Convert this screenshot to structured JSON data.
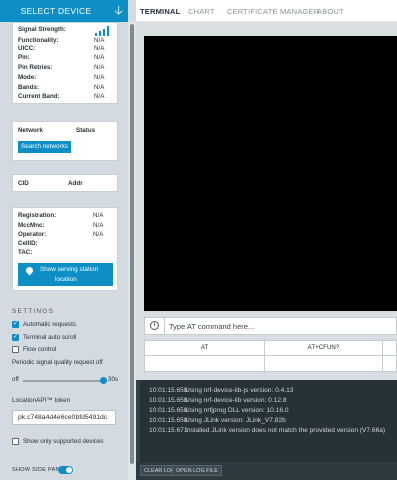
{
  "colors": {
    "accent": "#0d8fc6",
    "sidebar_bg": "#d4dbe0",
    "log_bg": "#263238",
    "terminal_bg": "#000000"
  },
  "sidebar": {
    "select_device": {
      "label": "SELECT DEVICE",
      "icon": "arrow-down-icon"
    },
    "device_info": [
      {
        "key": "Signal Strength:",
        "value": ""
      },
      {
        "key": "Functionality:",
        "value": "N/A"
      },
      {
        "key": "UICC:",
        "value": "N/A"
      },
      {
        "key": "Pin:",
        "value": "N/A"
      },
      {
        "key": "Pin Retries:",
        "value": "N/A"
      },
      {
        "key": "Mode:",
        "value": "N/A"
      },
      {
        "key": "Bands:",
        "value": "N/A"
      },
      {
        "key": "Current Band:",
        "value": "N/A"
      }
    ],
    "network": {
      "col_network": "Network",
      "col_status": "Status",
      "search_button": "Search networks"
    },
    "cells": {
      "col_cid": "CID",
      "col_addr": "Addr"
    },
    "registration": [
      {
        "key": "Registration:",
        "value": "N/A"
      },
      {
        "key": "MccMnc:",
        "value": "N/A"
      },
      {
        "key": "Operator:",
        "value": "N/A"
      },
      {
        "key": "CellID:",
        "value": ""
      },
      {
        "key": "TAC:",
        "value": ""
      }
    ],
    "show_station_button": {
      "line1": "Show serving station",
      "line2": "location",
      "icon": "location-pin-icon"
    },
    "settings": {
      "title": "SETTINGS",
      "automatic_requests": {
        "label": "Automatic requests",
        "checked": true
      },
      "terminal_auto_scroll": {
        "label": "Terminal auto scroll",
        "checked": true
      },
      "flow_control": {
        "label": "Flow control",
        "checked": false
      },
      "periodic_label": "Periodic signal quality request off",
      "slider_min": "off",
      "slider_max": "30s",
      "slider_value_fraction": 1.0,
      "token_label": "LocationAPI™ token",
      "token_value": "pk.c748a4d4e6ce0bfd5491dc",
      "supported_devices": {
        "label": "Show only supported devices",
        "checked": false
      }
    },
    "show_side_panel": {
      "label": "SHOW SIDE PANEL",
      "on": true
    }
  },
  "tabs": [
    {
      "label": "TERMINAL",
      "active": true
    },
    {
      "label": "CHART",
      "active": false
    },
    {
      "label": "CERTIFICATE MANAGER",
      "active": false
    },
    {
      "label": "ABOUT",
      "active": false
    }
  ],
  "terminal": {
    "command_placeholder": "Type AT command here...",
    "info_icon": "info-icon",
    "table_headers": [
      "AT",
      "AT+CFUN?"
    ]
  },
  "log": {
    "lines": [
      {
        "time": "10:01:15.658",
        "message": "Using nrf-device-lib-js version: 0.4.13"
      },
      {
        "time": "10:01:15.658",
        "message": "Using nrf-device-lib version: 0.12.8"
      },
      {
        "time": "10:01:15.658",
        "message": "Using nrfjprog DLL version: 10.16.0"
      },
      {
        "time": "10:01:15.658",
        "message": "Using JLink version: JLink_V7.82b"
      },
      {
        "time": "10:01:15.671",
        "message": "Installed JLink version does not match the provided version (V7.66a)"
      }
    ],
    "clear_button": "CLEAR LOG",
    "open_button": "OPEN LOG FILE"
  }
}
